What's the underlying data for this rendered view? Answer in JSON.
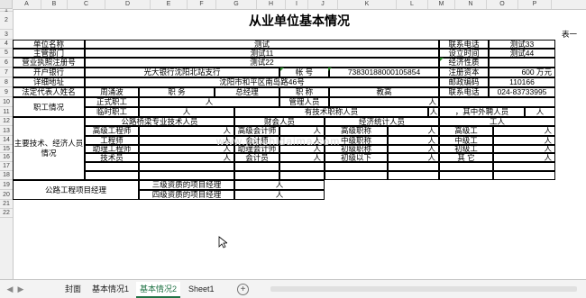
{
  "sheet": {
    "columns": [
      "A",
      "B",
      "C",
      "D",
      "E",
      "F",
      "G",
      "H",
      "I",
      "J",
      "K",
      "L",
      "M",
      "N",
      "O",
      "P"
    ],
    "rows": [
      "1",
      "2",
      "3",
      "4",
      "5",
      "6",
      "7",
      "8",
      "9",
      "10",
      "11",
      "12",
      "13",
      "14",
      "15",
      "16",
      "17",
      "18",
      "19",
      "20",
      "21",
      "22"
    ]
  },
  "form": {
    "title": "从业单位基本情况",
    "table_no": "表一",
    "unit_name_label": "单位名称",
    "unit_name_value": "测试",
    "dept_label": "主管部门",
    "dept_value": "测试11",
    "license_label": "营业执照注册号",
    "license_value": "测试22",
    "bank_label": "开户银行",
    "bank_value": "光大银行沈阳北站支行",
    "account_label": "帐    号",
    "account_value": "73830188000105854",
    "address_label": "详细地址",
    "address_value": "沈阳市和平区南岛路46号",
    "legal_rep_label": "法定代表人姓名",
    "legal_rep_value": "周涌波",
    "position_label": "职    务",
    "position_value": "总经理",
    "title_label": "职    称",
    "title_value": "教高",
    "phone_label": "联系电话",
    "phone_value": "测试33",
    "established_label": "设立时间",
    "established_value": "测试44",
    "econ_nature_label": "经济性质",
    "econ_nature_value": "",
    "reg_capital_label": "注册资本",
    "reg_capital_value": "600 万元",
    "postcode_label": "邮政编码",
    "postcode_value": "110166",
    "contact_phone_label": "联系电话",
    "contact_phone_value": "024-83733995",
    "staff_label": "职工情况",
    "formal_label": "正式职工",
    "temp_label": "临时职工",
    "person_unit": "人",
    "mgmt_label": "管理人员",
    "tech_title_label": "有技术职称人员",
    "outsourced_label": "，其中外聘人员",
    "tech_staff_label": "主要技术、经济人员情况",
    "road_tech_label": "公路桥梁专业技术人员",
    "finance_label": "财会人员",
    "econ_stats_label": "经济统计人员",
    "worker_label": "工人",
    "senior_engineer": "高级工程师",
    "engineer": "工程师",
    "assistant_engineer": "助理工程师",
    "technician": "技术员",
    "senior_accountant": "高级会计师",
    "accountant": "会计师",
    "assistant_accountant": "助理会计师",
    "clerk_accountant": "会计员",
    "senior_title": "高级职称",
    "mid_title": "中级职称",
    "junior_title": "初级职称",
    "below_junior": "初级以下",
    "senior_worker": "高级工",
    "mid_worker": "中级工",
    "junior_worker": "初级工",
    "other_worker": "其    它",
    "pm_label": "公路工程项目经理",
    "pm_grade3": "三级资质的项目经理",
    "pm_grade4": "四级资质的项目经理"
  },
  "watermark": "www.jiaishidaima.com",
  "tabs": {
    "items": [
      "封面",
      "基本情况1",
      "基本情况2",
      "Sheet1"
    ],
    "active": "基本情况2",
    "add_label": "+"
  }
}
